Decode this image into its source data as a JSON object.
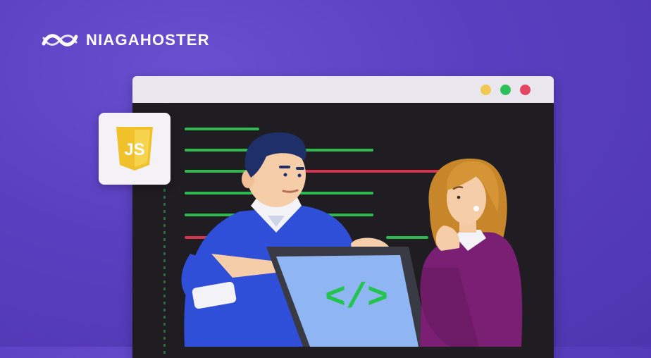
{
  "brand": {
    "name": "NIAGAHOSTER",
    "logo_icon": "infinity-wave-logo-icon"
  },
  "browser_window": {
    "controls": [
      "yellow-dot",
      "green-dot",
      "red-dot"
    ],
    "control_colors": [
      "#f0c953",
      "#2ec05a",
      "#e44662"
    ]
  },
  "badge": {
    "icon": "javascript-shield-icon",
    "text": "JS",
    "color": "#f0c12b"
  },
  "tablet": {
    "symbol": "</>",
    "symbol_color": "#22c44b",
    "screen_color": "#8fb6f2"
  },
  "colors": {
    "background": "#5a3fc0",
    "code_green": "#2fb84f",
    "code_red": "#d6334f",
    "man_sweater": "#2f4fd8",
    "woman_top": "#7a1f73"
  }
}
